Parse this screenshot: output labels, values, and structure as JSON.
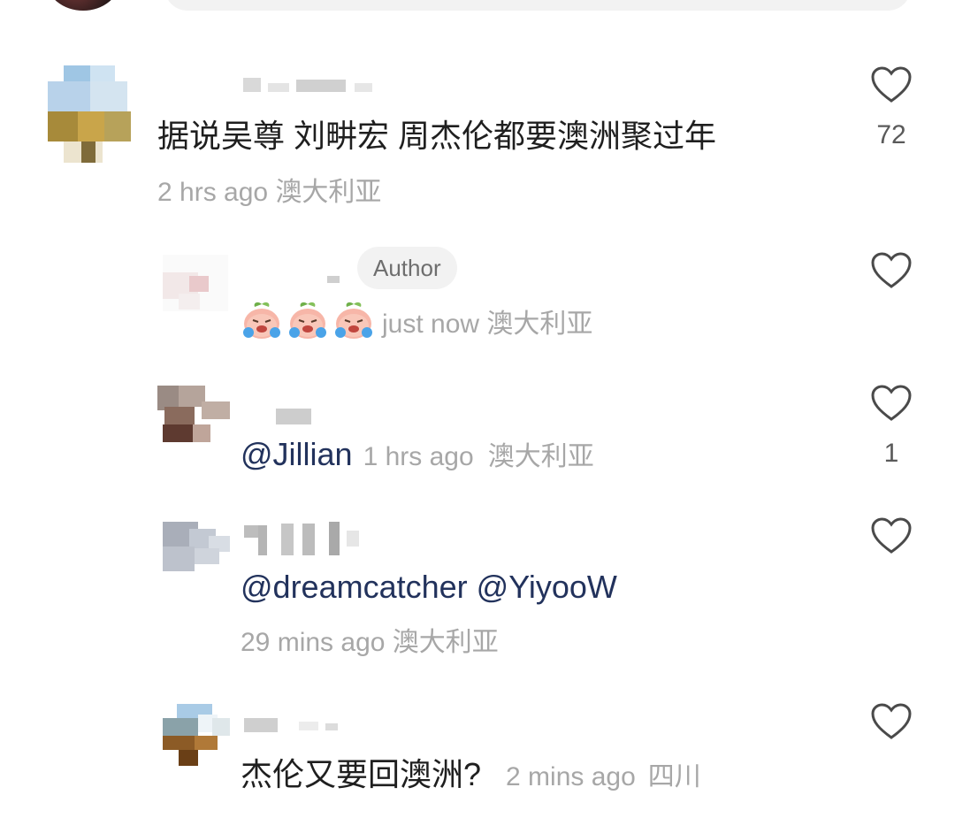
{
  "comments": [
    {
      "text": "据说吴尊 刘畊宏 周杰伦都要澳洲聚过年",
      "time": "2 hrs ago",
      "location": "澳大利亚",
      "likes": "72",
      "like_icon": "heart-outline-icon"
    },
    {
      "badge": "Author",
      "emoji_count": 3,
      "emoji_icon": "crying-peach-emoji",
      "time": "just now",
      "location": "澳大利亚",
      "likes": "",
      "like_icon": "heart-outline-icon"
    },
    {
      "text": "@Jillian",
      "time": "1 hrs ago",
      "location": "澳大利亚",
      "likes": "1",
      "like_icon": "heart-outline-icon"
    },
    {
      "text": "@dreamcatcher @YiyooW",
      "time": "29 mins ago",
      "location": "澳大利亚",
      "likes": "",
      "like_icon": "heart-outline-icon"
    },
    {
      "text": "杰伦又要回澳洲?",
      "time": "2 mins ago",
      "location": "四川",
      "likes": "",
      "like_icon": "heart-outline-icon"
    }
  ]
}
